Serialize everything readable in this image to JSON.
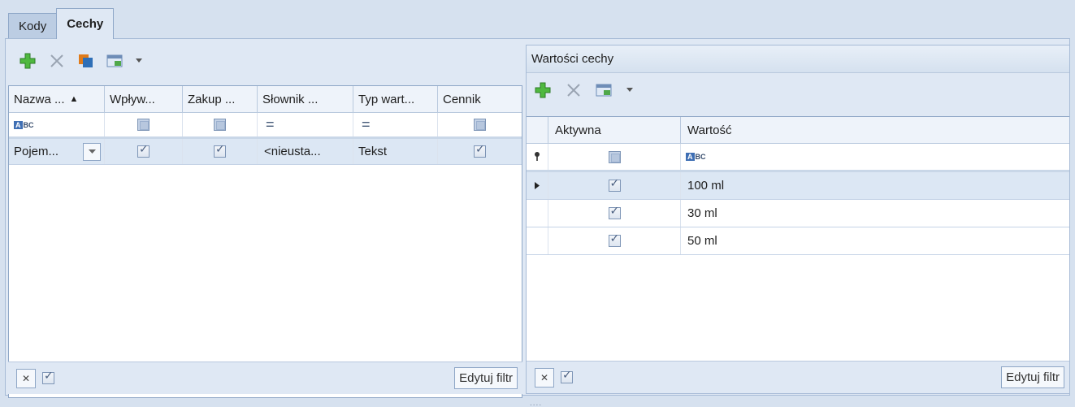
{
  "tabs": [
    {
      "label": "Kody"
    },
    {
      "label": "Cechy"
    }
  ],
  "left": {
    "toolbar": {
      "icons": [
        "add-icon",
        "delete-icon",
        "copy-icon",
        "export-icon",
        "dropdown-arrow-icon"
      ]
    },
    "columns": [
      "Nazwa ...",
      "Wpływ...",
      "Zakup ...",
      "Słownik ...",
      "Typ wart...",
      "Cennik"
    ],
    "sort_indicator": "▲",
    "filter_row": {
      "name_filter_icon": "abc-filter-icon",
      "dict_eq": "=",
      "type_eq": "="
    },
    "rows": [
      {
        "name": "Pojem...",
        "wplyw": true,
        "zakup": true,
        "slownik": "<nieusta...",
        "typ": "Tekst",
        "cennik": true
      }
    ],
    "bottom": {
      "close_glyph": "✕",
      "filter_checked": true,
      "edit_filter": "Edytuj filtr"
    }
  },
  "right": {
    "title": "Wartości cechy",
    "toolbar": {
      "icons": [
        "add-icon",
        "delete-icon",
        "export-icon",
        "dropdown-arrow-icon"
      ]
    },
    "columns": [
      "Aktywna",
      "Wartość"
    ],
    "rows": [
      {
        "active": true,
        "value": "100 ml",
        "selected": true
      },
      {
        "active": true,
        "value": "30 ml",
        "selected": false
      },
      {
        "active": true,
        "value": "50 ml",
        "selected": false
      }
    ],
    "bottom": {
      "close_glyph": "✕",
      "filter_checked": true,
      "edit_filter": "Edytuj filtr"
    }
  },
  "splitter": "....",
  "colors": {
    "frame": "#d6e1ef",
    "selection": "#dce7f4",
    "border": "#8ea6c6",
    "add_green": "#3aa33a"
  }
}
